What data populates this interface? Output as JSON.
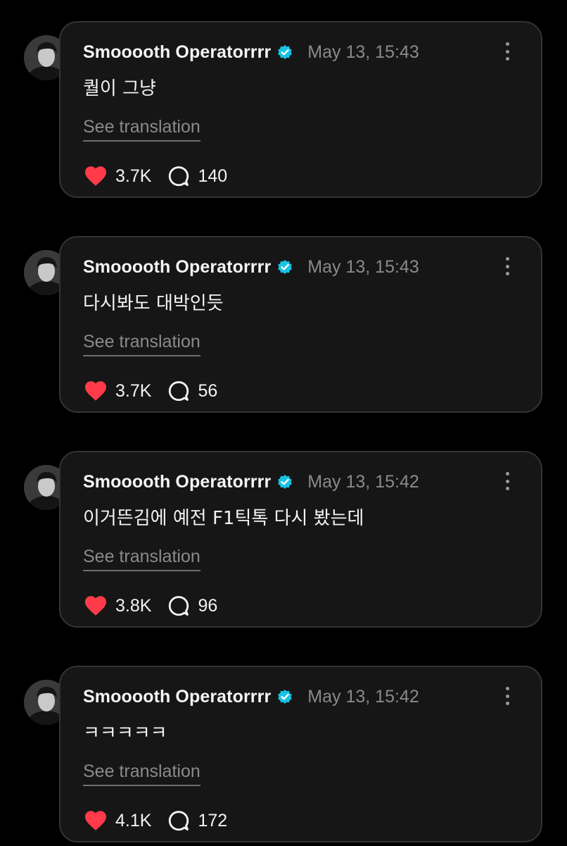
{
  "colors": {
    "background": "#000000",
    "card_background": "#161616",
    "card_border": "#333333",
    "verified_badge": "#17c3e6",
    "like_heart": "#ff3b4a",
    "secondary_text": "#8a8a8a"
  },
  "posts": [
    {
      "username": "Smooooth Operatorrrr",
      "timestamp": "May 13, 15:43",
      "text": "퀄이 그냥",
      "translation_label": "See translation",
      "likes": "3.7K",
      "comments": "140"
    },
    {
      "username": "Smooooth Operatorrrr",
      "timestamp": "May 13, 15:43",
      "text": "다시봐도 대박인듯",
      "translation_label": "See translation",
      "likes": "3.7K",
      "comments": "56"
    },
    {
      "username": "Smooooth Operatorrrr",
      "timestamp": "May 13, 15:42",
      "text": "이거뜬김에 예전 F1틱톡 다시 봤는데",
      "translation_label": "See translation",
      "likes": "3.8K",
      "comments": "96"
    },
    {
      "username": "Smooooth Operatorrrr",
      "timestamp": "May 13, 15:42",
      "text": "ㅋㅋㅋㅋㅋ",
      "translation_label": "See translation",
      "likes": "4.1K",
      "comments": "172"
    }
  ],
  "icons": {
    "verified": "verified-badge-icon",
    "more": "more-options-icon",
    "like": "heart-icon",
    "comment": "comment-bubble-icon",
    "avatar": "user-avatar"
  }
}
